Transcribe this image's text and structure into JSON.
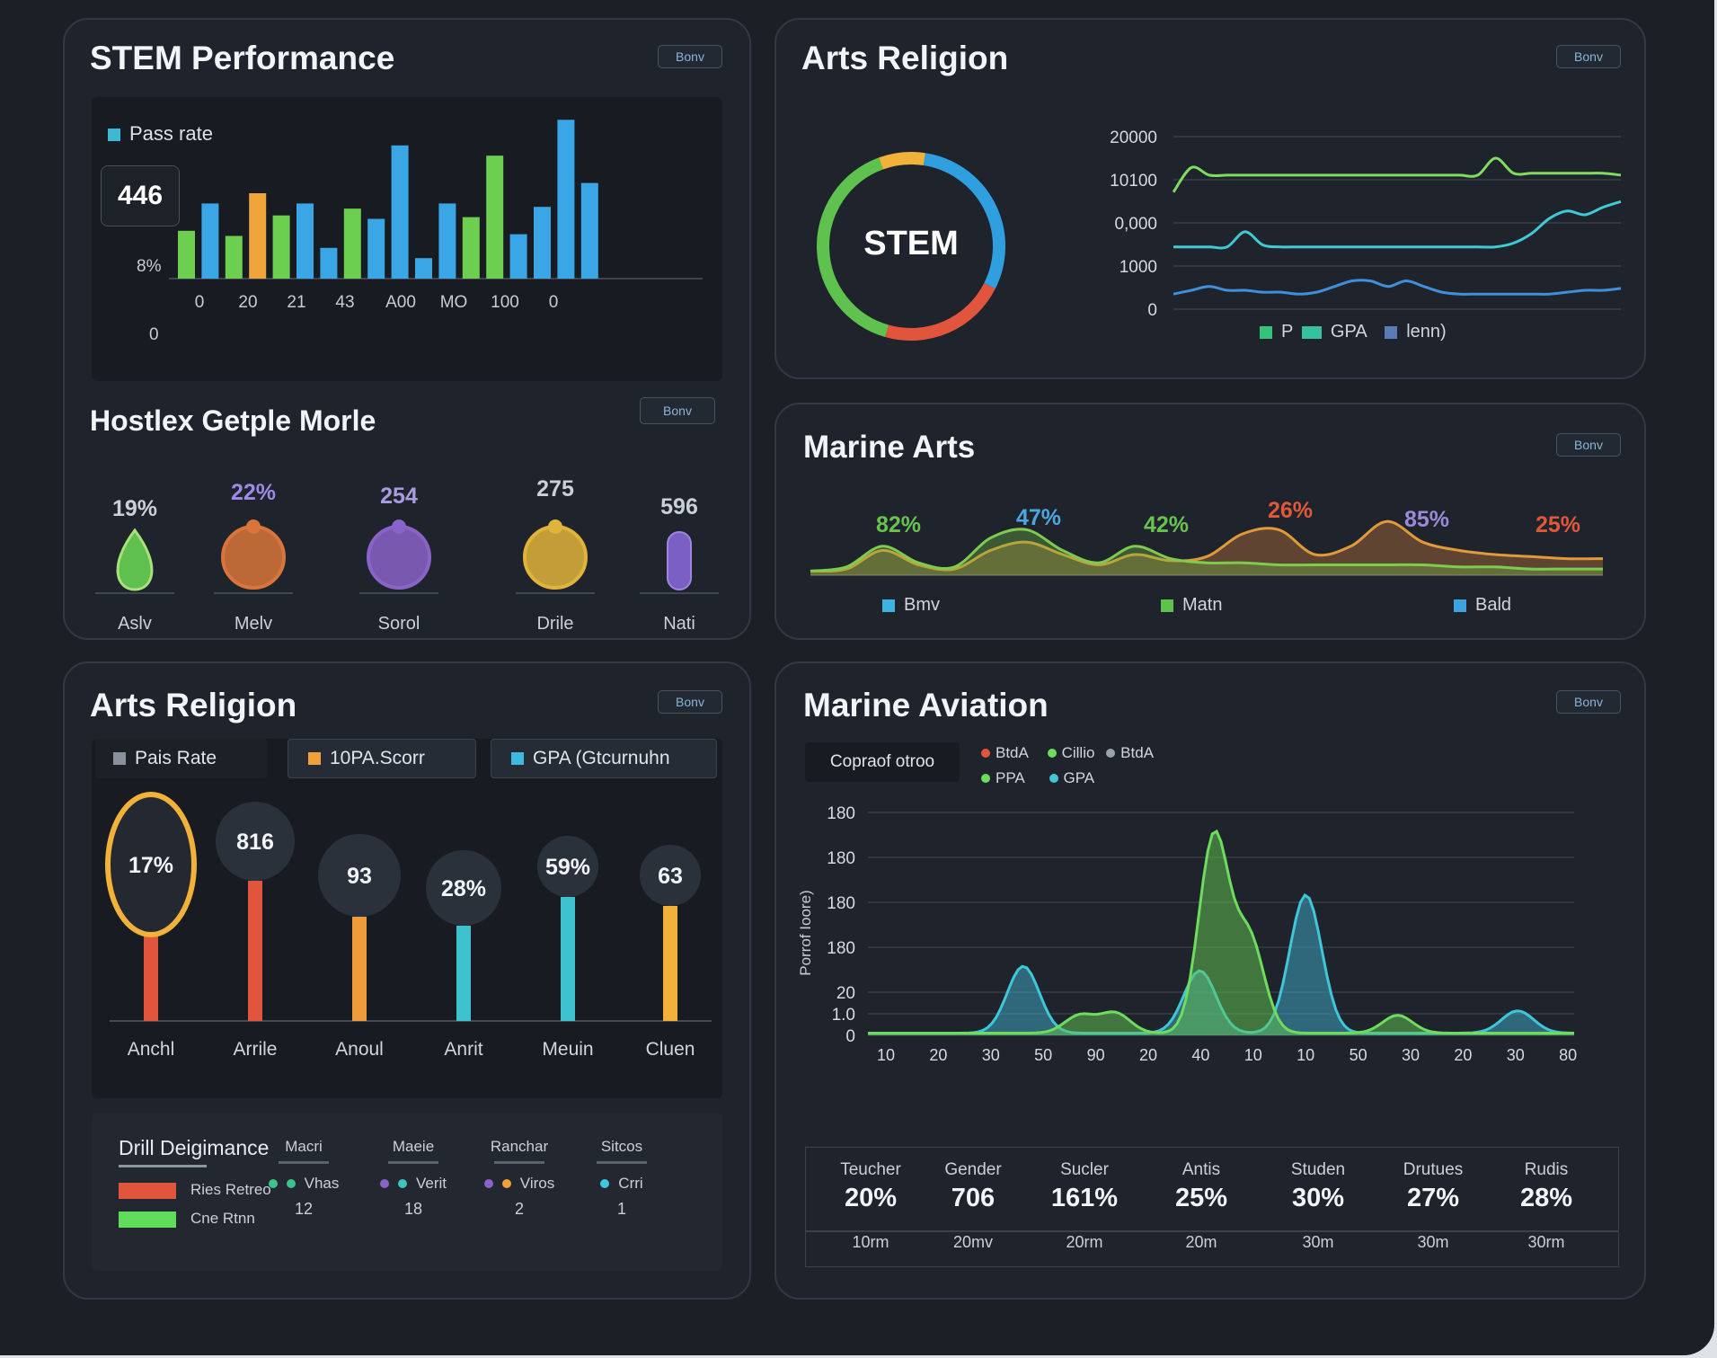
{
  "panels": {
    "stem": {
      "title": "STEM Performance",
      "button": "Bonv",
      "legend": "Pass rate",
      "callout": "446",
      "y_ticks": [
        "8%",
        "0"
      ]
    },
    "hostex": {
      "title": "Hostlex Getple Morle",
      "button": "Bonv",
      "items": [
        {
          "value": "19%",
          "label": "Aslv",
          "color": "#5fbf4f",
          "fill_pct": 35
        },
        {
          "value": "22%",
          "label": "Melv",
          "color": "#d9743a",
          "fill_pct": 48
        },
        {
          "value": "254",
          "label": "Sorol",
          "color": "#8a63c8",
          "fill_pct": 48
        },
        {
          "value": "275",
          "label": "Drile",
          "color": "#e0b43b",
          "fill_pct": 48
        },
        {
          "value": "596",
          "label": "Nati",
          "color": "#7b5fc4",
          "fill_pct": 42
        }
      ]
    },
    "arts_top": {
      "title": "Arts Religion",
      "button": "Bonv",
      "donut_label": "STEM",
      "y_ticks": [
        "20000",
        "10100",
        "0,000",
        "1000",
        "0"
      ],
      "legend": [
        "P",
        "GPA",
        "lenn)"
      ]
    },
    "marine_arts": {
      "title": "Marine Arts",
      "button": "Bonv",
      "peaks": [
        {
          "label": "82%",
          "color": "#67c34e"
        },
        {
          "label": "47%",
          "color": "#4ea6e0"
        },
        {
          "label": "42%",
          "color": "#67c34e"
        },
        {
          "label": "26%",
          "color": "#e0573a"
        },
        {
          "label": "85%",
          "color": "#9a8ad8"
        },
        {
          "label": "25%",
          "color": "#e0573a"
        }
      ],
      "legend": [
        "Bmv",
        "Matn",
        "Bald"
      ]
    },
    "arts_bottom": {
      "title": "Arts Religion",
      "button": "Bonv",
      "tabs": [
        "Pais Rate",
        "10PA.Scorr",
        "GPA (Gtcurnuhn"
      ],
      "bubbles": [
        {
          "value": "17%",
          "label": "Anchl",
          "stem_color": "#e2553d"
        },
        {
          "value": "816",
          "label": "Arrile",
          "stem_color": "#e2553d"
        },
        {
          "value": "93",
          "label": "Anoul",
          "stem_color": "#ef9a3c"
        },
        {
          "value": "28%",
          "label": "Anrit",
          "stem_color": "#3fc2d0"
        },
        {
          "value": "59%",
          "label": "Meuin",
          "stem_color": "#3fc2d0"
        },
        {
          "value": "63",
          "label": "Cluen",
          "stem_color": "#f2b23a"
        }
      ],
      "drill": {
        "title": "Drill Deigimance",
        "legend": [
          "Ries Retreo",
          "Cne Rtnn"
        ],
        "columns": [
          {
            "head": "Macri",
            "tag": "Vhas",
            "count": "12"
          },
          {
            "head": "Maeie",
            "tag": "Verit",
            "count": "18"
          },
          {
            "head": "Ranchar",
            "tag": "Viros",
            "count": "2"
          },
          {
            "head": "Sitcos",
            "tag": "Crri",
            "count": "1"
          }
        ]
      }
    },
    "marine_aviation": {
      "title": "Marine Aviation",
      "button": "Bonv",
      "filter": "Copraof otroo",
      "legend": [
        "BtdA",
        "Cillio",
        "BtdA",
        "PPA",
        "GPA"
      ],
      "y_axis_label": "Porrof Ioore)",
      "y_ticks": [
        "180",
        "180",
        "180",
        "180",
        "20",
        "1.0",
        "0"
      ],
      "x_ticks": [
        "10",
        "20",
        "30",
        "50",
        "90",
        "20",
        "40",
        "10",
        "10",
        "50",
        "30",
        "20",
        "30",
        "80"
      ],
      "stats": [
        {
          "label": "Teucher",
          "value": "20%",
          "sub": "10rm"
        },
        {
          "label": "Gender",
          "value": "706",
          "sub": "20mv"
        },
        {
          "label": "Sucler",
          "value": "161%",
          "sub": "20rm"
        },
        {
          "label": "Antis",
          "value": "25%",
          "sub": "20m"
        },
        {
          "label": "Studen",
          "value": "30%",
          "sub": "30m"
        },
        {
          "label": "Drutues",
          "value": "27%",
          "sub": "30m"
        },
        {
          "label": "Rudis",
          "value": "28%",
          "sub": "30rm"
        }
      ]
    }
  },
  "chart_data": [
    {
      "id": "stem-bars",
      "type": "bar",
      "title": "STEM Performance",
      "legend": "Pass rate",
      "x_tick_labels": [
        "0",
        "20",
        "21",
        "43",
        "A00",
        "MO",
        "100",
        "0"
      ],
      "values": [
        28,
        44,
        25,
        50,
        37,
        44,
        18,
        41,
        35,
        78,
        12,
        44,
        36,
        72,
        26,
        42,
        93,
        56
      ],
      "colors": [
        "green",
        "blue",
        "green",
        "orange",
        "green",
        "blue",
        "blue",
        "green",
        "blue",
        "blue",
        "blue",
        "blue",
        "green",
        "green",
        "blue",
        "blue",
        "blue",
        "blue"
      ],
      "ylim": [
        0,
        100
      ]
    },
    {
      "id": "arts-donut",
      "type": "pie",
      "center_label": "STEM",
      "values": [
        8,
        30,
        22,
        40
      ],
      "colors": [
        "#f0b23a",
        "#2f9fe0",
        "#e2553d",
        "#5fc24f"
      ]
    },
    {
      "id": "arts-lines",
      "type": "line",
      "y_tick_labels": [
        "20000",
        "10100",
        "0,000",
        "1000",
        "0"
      ],
      "series": [
        {
          "color": "#7fdc5e",
          "values": [
            62,
            75,
            71,
            71,
            71,
            71,
            71,
            71,
            71,
            71,
            71,
            71,
            71,
            71,
            71,
            71,
            71,
            71,
            80,
            72,
            72,
            72,
            72,
            72,
            72,
            71
          ]
        },
        {
          "color": "#42c9d6",
          "values": [
            33,
            33,
            33,
            33,
            41,
            34,
            33,
            33,
            33,
            33,
            33,
            33,
            33,
            33,
            33,
            33,
            33,
            33,
            33,
            35,
            40,
            48,
            52,
            50,
            54,
            57
          ]
        },
        {
          "color": "#3f8fdc",
          "values": [
            8,
            10,
            12,
            10,
            10,
            9,
            9,
            8,
            9,
            12,
            15,
            15,
            12,
            15,
            12,
            9,
            8,
            8,
            8,
            8,
            8,
            8,
            9,
            10,
            10,
            11
          ]
        }
      ]
    },
    {
      "id": "marine-arts-area",
      "type": "area",
      "peak_labels": [
        "82%",
        "47%",
        "42%",
        "26%",
        "85%",
        "25%"
      ],
      "series": [
        {
          "color": "#7ecb4f",
          "values": [
            2,
            4,
            14,
            6,
            4,
            18,
            22,
            12,
            6,
            14,
            8,
            6,
            6,
            5,
            5,
            5,
            5,
            5,
            4,
            4,
            3,
            3,
            3
          ]
        },
        {
          "color": "#e09a3a",
          "values": [
            2,
            3,
            12,
            5,
            3,
            12,
            16,
            10,
            5,
            10,
            7,
            9,
            20,
            22,
            10,
            14,
            26,
            16,
            12,
            10,
            9,
            8,
            8
          ]
        }
      ]
    },
    {
      "id": "arts-bubbles",
      "type": "bar",
      "categories": [
        "Anchl",
        "Arrile",
        "Anoul",
        "Anrit",
        "Meuin",
        "Cluen"
      ],
      "labels": [
        "17%",
        "816",
        "93",
        "28%",
        "59%",
        "63"
      ]
    },
    {
      "id": "marine-aviation-area",
      "type": "area",
      "y_tick_labels": [
        "180",
        "180",
        "180",
        "180",
        "20",
        "1.0",
        "0"
      ],
      "x_tick_labels": [
        "10",
        "20",
        "30",
        "50",
        "90",
        "20",
        "40",
        "10",
        "10",
        "50",
        "30",
        "20",
        "30",
        "80"
      ],
      "series": [
        {
          "name": "GPA",
          "color": "#3fc6d8",
          "peaks": [
            [
              0.22,
              0.3
            ],
            [
              0.62,
              0.62
            ],
            [
              0.92,
              0.1
            ],
            [
              0.47,
              0.28
            ]
          ]
        },
        {
          "name": "PPA",
          "color": "#6fdc5e",
          "peaks": [
            [
              0.49,
              0.88
            ],
            [
              0.54,
              0.42
            ],
            [
              0.3,
              0.08
            ],
            [
              0.35,
              0.09
            ],
            [
              0.75,
              0.08
            ]
          ]
        }
      ]
    }
  ]
}
